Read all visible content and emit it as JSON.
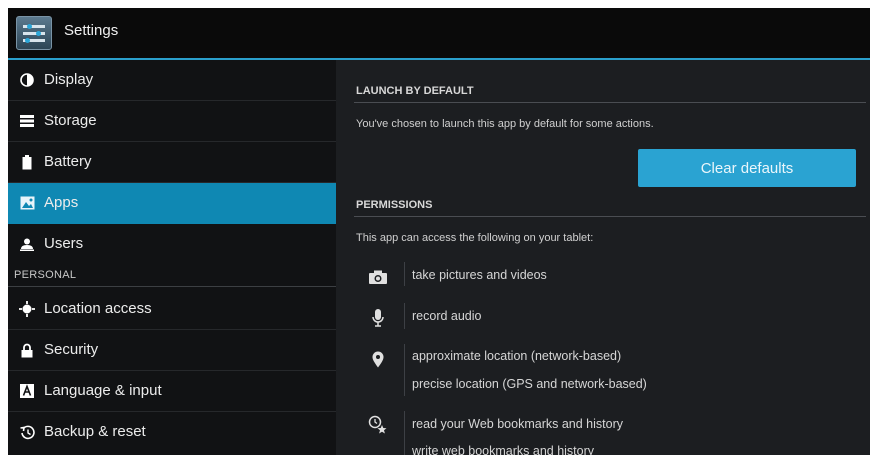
{
  "header": {
    "title": "Settings",
    "icon": "settings-icon"
  },
  "sidebar": {
    "items": [
      {
        "label": "Display",
        "icon": "display-icon"
      },
      {
        "label": "Storage",
        "icon": "storage-icon"
      },
      {
        "label": "Battery",
        "icon": "battery-icon"
      },
      {
        "label": "Apps",
        "icon": "apps-icon",
        "selected": true
      },
      {
        "label": "Users",
        "icon": "users-icon"
      },
      {
        "label": "Location access",
        "icon": "location-access-icon"
      },
      {
        "label": "Security",
        "icon": "lock-icon"
      },
      {
        "label": "Language & input",
        "icon": "keyboard-icon"
      },
      {
        "label": "Backup & reset",
        "icon": "restore-icon"
      }
    ],
    "sections": [
      {
        "label": "PERSONAL"
      }
    ]
  },
  "detail": {
    "launch_default": {
      "header": "LAUNCH BY DEFAULT",
      "text": "You've chosen to launch this app by default for some actions.",
      "button": "Clear defaults"
    },
    "permissions": {
      "header": "PERMISSIONS",
      "intro": "This app can access the following on your tablet:",
      "groups": [
        {
          "icon": "camera-icon",
          "items": [
            "take pictures and videos"
          ]
        },
        {
          "icon": "microphone-icon",
          "items": [
            "record audio"
          ]
        },
        {
          "icon": "location-pin-icon",
          "items": [
            "approximate location (network-based)",
            "precise location (GPS and network-based)"
          ]
        },
        {
          "icon": "bookmarks-icon",
          "items": [
            "read your Web bookmarks and history",
            "write web bookmarks and history"
          ]
        }
      ]
    }
  },
  "colors": {
    "accent": "#2aa3d2",
    "selected": "#0f88b3",
    "background": "#000000"
  }
}
